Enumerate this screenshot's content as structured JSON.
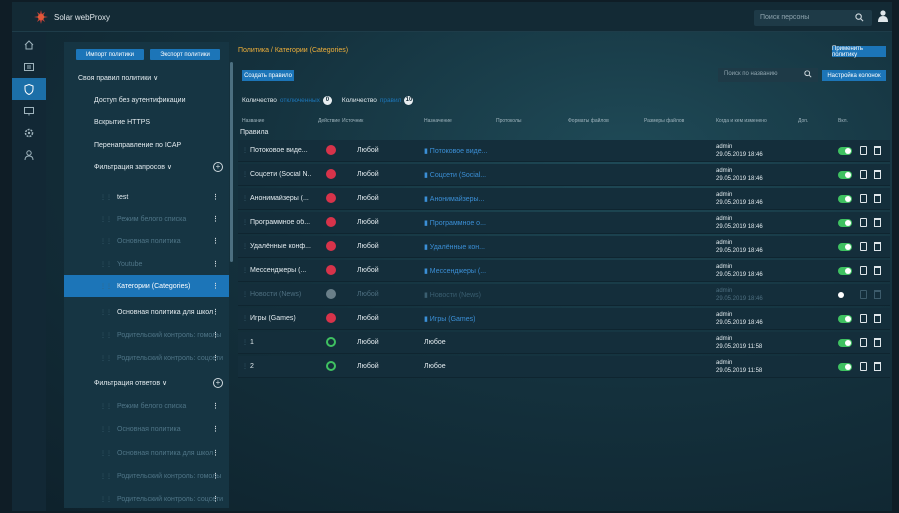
{
  "app": {
    "title": "Solar webProxy"
  },
  "topbar": {
    "search_placeholder": "Поиск персоны"
  },
  "sidebar": {
    "import_label": "Импорт политики",
    "export_label": "Экспорт политики",
    "items": [
      {
        "label": "Своя правил политики ∨",
        "level": "top",
        "dim": false,
        "dots": false
      },
      {
        "label": "Доступ без аутентификации",
        "level": "indent",
        "dim": false,
        "dots": false
      },
      {
        "label": "Вскрытие HTTPS",
        "level": "indent",
        "dim": false,
        "dots": false
      },
      {
        "label": "Перенаправление по ICAP",
        "level": "indent",
        "dim": false,
        "dots": false
      },
      {
        "label": "Фильтрация запросов ∨",
        "level": "indent",
        "dim": false,
        "dots": false,
        "plus": true
      },
      {
        "label": "test",
        "level": "sub",
        "dim": false,
        "dots": true
      },
      {
        "label": "Режим белого списка",
        "level": "sub",
        "dim": true,
        "dots": true
      },
      {
        "label": "Основная политика",
        "level": "sub",
        "dim": true,
        "dots": true
      },
      {
        "label": "Youtube",
        "level": "sub",
        "dim": true,
        "dots": true
      },
      {
        "label": "Категории (Categories)",
        "level": "sub",
        "dim": false,
        "dots": true,
        "selected": true
      },
      {
        "label": "Основная политика для школ",
        "level": "sub",
        "dim": false,
        "dots": true
      },
      {
        "label": "Родительский контроль: гомолы",
        "level": "sub",
        "dim": true,
        "dots": true
      },
      {
        "label": "Родительский контроль: соцсети",
        "level": "sub",
        "dim": true,
        "dots": true
      },
      {
        "label": "Фильтрация ответов ∨",
        "level": "indent",
        "dim": false,
        "dots": false,
        "plus": true
      },
      {
        "label": "Режим белого списка",
        "level": "sub",
        "dim": true,
        "dots": true
      },
      {
        "label": "Основная политика",
        "level": "sub",
        "dim": true,
        "dots": true
      },
      {
        "label": "Основная политика для школ",
        "level": "sub",
        "dim": true,
        "dots": true
      },
      {
        "label": "Родительский контроль: гомолы",
        "level": "sub",
        "dim": true,
        "dots": true
      },
      {
        "label": "Родительский контроль: соцсети",
        "level": "sub",
        "dim": true,
        "dots": true
      }
    ]
  },
  "main": {
    "breadcrumb": "Политика / Категории (Categories)",
    "apply_label": "Применить политику",
    "create_label": "Создать правило",
    "filter_placeholder": "Поиск по названию",
    "columns_label": "Настройка колонок",
    "counts": {
      "label1": "Количество",
      "hl1": "отключенных",
      "val1": "0",
      "label2": "Количество",
      "hl2": "правил",
      "val2": "10"
    },
    "headers": [
      "Название",
      "Действие",
      "Источник",
      "Назначение",
      "Протоколы",
      "Форматы файлов",
      "Размеры файлов",
      "Когда и кем изменено",
      "Доп.",
      "Вкл."
    ],
    "section_label": "Правила",
    "rows": [
      {
        "name": "Потоковое виде...",
        "action": "blocked",
        "source": "Любой",
        "dest": "Потоковое виде...",
        "dest_icon": true,
        "user": "admin",
        "date": "29.05.2019 18:46",
        "enabled": true,
        "disabled": false
      },
      {
        "name": "Соцсети (Social N...",
        "action": "blocked",
        "source": "Любой",
        "dest": "Соцсети (Social...",
        "dest_icon": true,
        "user": "admin",
        "date": "29.05.2019 18:46",
        "enabled": true,
        "disabled": false
      },
      {
        "name": "Анонимайзеры (...",
        "action": "blocked",
        "source": "Любой",
        "dest": "Анонимайзеры...",
        "dest_icon": true,
        "user": "admin",
        "date": "29.05.2019 18:46",
        "enabled": true,
        "disabled": false
      },
      {
        "name": "Программное об...",
        "action": "blocked",
        "source": "Любой",
        "dest": "Программное о...",
        "dest_icon": true,
        "user": "admin",
        "date": "29.05.2019 18:46",
        "enabled": true,
        "disabled": false
      },
      {
        "name": "Удалённые конф...",
        "action": "blocked",
        "source": "Любой",
        "dest": "Удалённые кон...",
        "dest_icon": true,
        "user": "admin",
        "date": "29.05.2019 18:46",
        "enabled": true,
        "disabled": false
      },
      {
        "name": "Мессенджеры (...",
        "action": "blocked",
        "source": "Любой",
        "dest": "Мессенджеры (...",
        "dest_icon": true,
        "user": "admin",
        "date": "29.05.2019 18:46",
        "enabled": true,
        "disabled": false
      },
      {
        "name": "Новости (News)",
        "action": "off",
        "source": "Любой",
        "dest": "Новости (News)",
        "dest_icon": true,
        "user": "admin",
        "date": "29.05.2019 18:46",
        "enabled": false,
        "disabled": true
      },
      {
        "name": "Игры (Games)",
        "action": "blocked",
        "source": "Любой",
        "dest": "Игры (Games)",
        "dest_icon": true,
        "user": "admin",
        "date": "29.05.2019 18:46",
        "enabled": true,
        "disabled": false
      },
      {
        "name": "1",
        "action": "allow",
        "source": "Любой",
        "dest": "Любое",
        "dest_icon": false,
        "user": "admin",
        "date": "29.05.2019 11:58",
        "enabled": true,
        "disabled": false
      },
      {
        "name": "2",
        "action": "allow",
        "source": "Любой",
        "dest": "Любое",
        "dest_icon": false,
        "user": "admin",
        "date": "29.05.2019 11:58",
        "enabled": true,
        "disabled": false
      }
    ]
  },
  "colors": {
    "accent": "#1c75b8",
    "breadcrumb": "#f0b03a",
    "blocked": "#d8334a",
    "allow": "#3fc161"
  }
}
